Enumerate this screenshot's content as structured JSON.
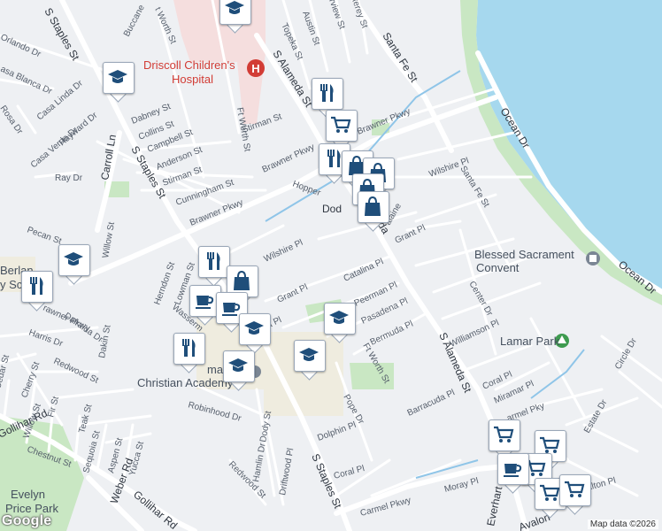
{
  "map": {
    "attribution": "Map data ©2026",
    "logo": "Google",
    "colors": {
      "water": "#a6d8ee",
      "park": "#c9e7c3",
      "hospital": "#f5dede",
      "school": "#efecdf",
      "road": "#ffffff",
      "land": "#eef0f3",
      "pin_icon": "#1f4e7a"
    },
    "places": {
      "hospital_line1": "Driscoll Children's",
      "hospital_line2": "Hospital",
      "convent": "Blessed Sacrament",
      "convent_line2": "Convent",
      "park_lamar": "Lamar Park",
      "school_line1": "Christian Academy",
      "school_fragment": "mapl",
      "park_evelyn_1": "Evelyn",
      "park_evelyn_2": "Price Park",
      "berlanga_1": "Berlan",
      "berlanga_2": "y Sc"
    },
    "streets": {
      "s_staples_top": "S Staples St",
      "s_staples_mid": "S Staples St",
      "s_staples_bottom": "S Staples St",
      "s_alameda_top": "S Alameda St",
      "s_alameda_mid": "S Alameda St",
      "s_alameda_bottom": "S Alameda St",
      "santa_fe_top": "Santa Fe St",
      "santa_fe_mid": "Santa Fe St",
      "ocean_dr_top": "Ocean Dr",
      "ocean_dr_bottom": "Ocean Dr",
      "brawner_pkwy_1": "Brawner Pkwy",
      "brawner_pkwy_2": "Brawner Pkwy",
      "brawner_pkwy_3": "Brawner Pkwy",
      "brawner_pkwy_4": "Brawner Pkwy",
      "carroll_ln": "Carroll Ln",
      "gollihar_rd_1": "Gollihar Rd",
      "gollihar_rd_2": "Gollihar Rd",
      "weber_rd": "Weber Rd",
      "carmel_pkwy_1": "Carmel Pkwy",
      "carmel_pkwy_2": "Carmel Pkwy",
      "everhart": "Everhart",
      "avalon": "Avalon",
      "orlando_dr": "Orlando Dr",
      "buccaneer": "Buccane",
      "ft_worth_top": "t Worth St",
      "ft_worth_mid": "Ft Worth St",
      "ft_worth_bottom": "Ft Worth St",
      "topeka": "Topeka St",
      "austin": "Austin St",
      "fairview": "rview St",
      "monterey": "terey St",
      "casa_linda": "Casa Linda Dr",
      "casa_blanca": "asa Blanca Dr",
      "casa_verde": "Casa Verde Dr",
      "hayward": "Hayward Dr",
      "rosa": "Rosa Dr",
      "dabney": "Dabney St",
      "collins": "Collins St",
      "campbell": "Campbell St",
      "anderson": "Anderson St",
      "stirman_1": "Stirman St",
      "stirman_2": "Stirman St",
      "cunningham": "Cunningham St",
      "ray": "Ray Dr",
      "pecan": "Pecan St",
      "willow_top": "Willow St",
      "willow_bottom": "Willow St",
      "herndon": "Herndon St",
      "lowman": "Lowman St",
      "wasserman": "Wasserm",
      "hopper": "Hopper",
      "dodd": "Dod",
      "wilshire_1": "Wilshire Pl",
      "wilshire_2": "Wilshire Pl",
      "grant_1": "Grant Pl",
      "grant_2": "Grant Pl",
      "catalina": "Catalina Pl",
      "catalina_left": "ina Pl",
      "peerman": "Peerman Pl",
      "pasadena": "Pasadena Pl",
      "bermuda": "Bermuda Pl",
      "williamson": "Williamson Pl",
      "center": "Center Dr",
      "circle": "Circle Dr",
      "estate": "Estate Dr",
      "barracuda": "Barracuda Pl",
      "coral_1": "Coral Pl",
      "coral_2": "Coral Pl",
      "miramar": "Miramar Pl",
      "dolphin": "Dolphin Pl",
      "moray": "Moray Pl",
      "carmel_pl": "armel Pky",
      "walton": "alton Pl",
      "harris": "Harris Dr",
      "dalraida": "Dalraida Dr",
      "dakin": "Dakin St",
      "cedar": "Cedar St",
      "cherry": "Cherry St",
      "redwood_1": "Redwood St",
      "redwood_2": "Redwood St",
      "fir": "Fir St",
      "teak": "Teak St",
      "chestnut": "Chestnut St",
      "sequoia": "Sequoia St",
      "aspen": "Aspen St",
      "yucca": "Yucca St",
      "robinhood": "Robinhood Dr",
      "dody": "Dody St",
      "hamlin": "Hamlin Dr",
      "driftwood": "Driftwood Pl",
      "pope": "Pope Dr",
      "malaine": "alaine",
      "brawner_left": "rawner Pkwy",
      "alameda_frag": "eda"
    },
    "pins": [
      {
        "kind": "school",
        "icon": "graduation-cap-icon"
      },
      {
        "kind": "school",
        "icon": "graduation-cap-icon"
      },
      {
        "kind": "restaurant",
        "icon": "fork-knife-icon"
      },
      {
        "kind": "grocery",
        "icon": "shopping-cart-icon"
      },
      {
        "kind": "restaurant",
        "icon": "fork-knife-icon"
      },
      {
        "kind": "shopping",
        "icon": "shopping-bag-icon"
      },
      {
        "kind": "shopping",
        "icon": "shopping-bag-icon"
      },
      {
        "kind": "shopping",
        "icon": "shopping-bag-icon"
      },
      {
        "kind": "shopping",
        "icon": "shopping-bag-icon"
      },
      {
        "kind": "school",
        "icon": "graduation-cap-icon"
      },
      {
        "kind": "restaurant",
        "icon": "fork-knife-icon"
      },
      {
        "kind": "restaurant",
        "icon": "fork-knife-icon"
      },
      {
        "kind": "shopping",
        "icon": "shopping-bag-icon"
      },
      {
        "kind": "cafe",
        "icon": "coffee-cup-icon"
      },
      {
        "kind": "cafe",
        "icon": "coffee-cup-icon"
      },
      {
        "kind": "school",
        "icon": "graduation-cap-icon"
      },
      {
        "kind": "restaurant",
        "icon": "fork-knife-icon"
      },
      {
        "kind": "school",
        "icon": "graduation-cap-icon"
      },
      {
        "kind": "school",
        "icon": "graduation-cap-icon"
      },
      {
        "kind": "school",
        "icon": "graduation-cap-icon"
      },
      {
        "kind": "grocery",
        "icon": "shopping-cart-icon"
      },
      {
        "kind": "grocery",
        "icon": "shopping-cart-icon"
      },
      {
        "kind": "grocery",
        "icon": "shopping-cart-icon"
      },
      {
        "kind": "cafe",
        "icon": "coffee-cup-icon"
      },
      {
        "kind": "grocery",
        "icon": "shopping-cart-icon"
      },
      {
        "kind": "grocery",
        "icon": "shopping-cart-icon"
      }
    ]
  }
}
